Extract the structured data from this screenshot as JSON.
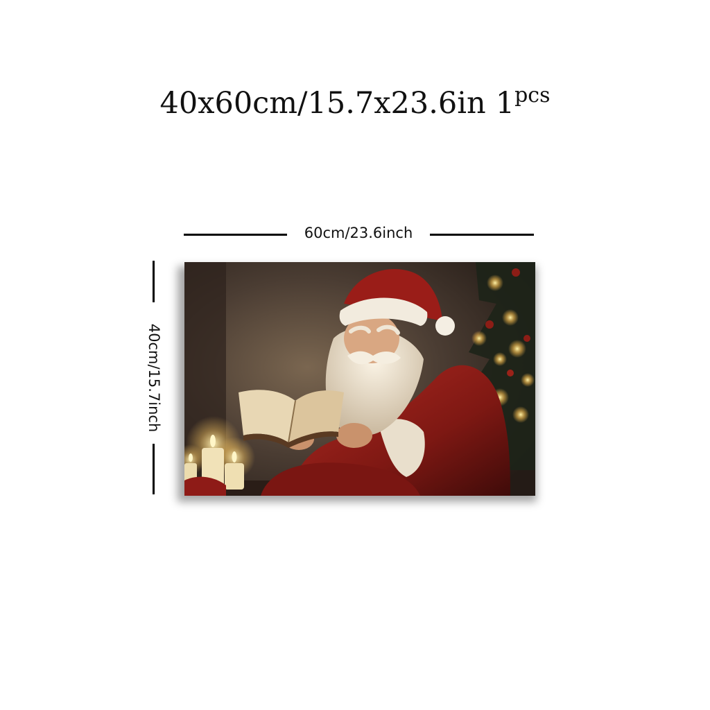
{
  "title": {
    "size_text": "40x60cm/15.7x23.6in",
    "quantity_number": "1",
    "quantity_unit": "pcs"
  },
  "dimensions": {
    "width_label": "60cm/23.6inch",
    "height_label": "40cm/15.7inch"
  },
  "artwork": {
    "subject": "Santa Claus reading a book by candlelight beside a Christmas tree",
    "colors": {
      "background": "#3b2e26",
      "santa_red": "#8e1b17",
      "fur_white": "#efe6d6",
      "candle_glow": "#f3d27a"
    }
  }
}
